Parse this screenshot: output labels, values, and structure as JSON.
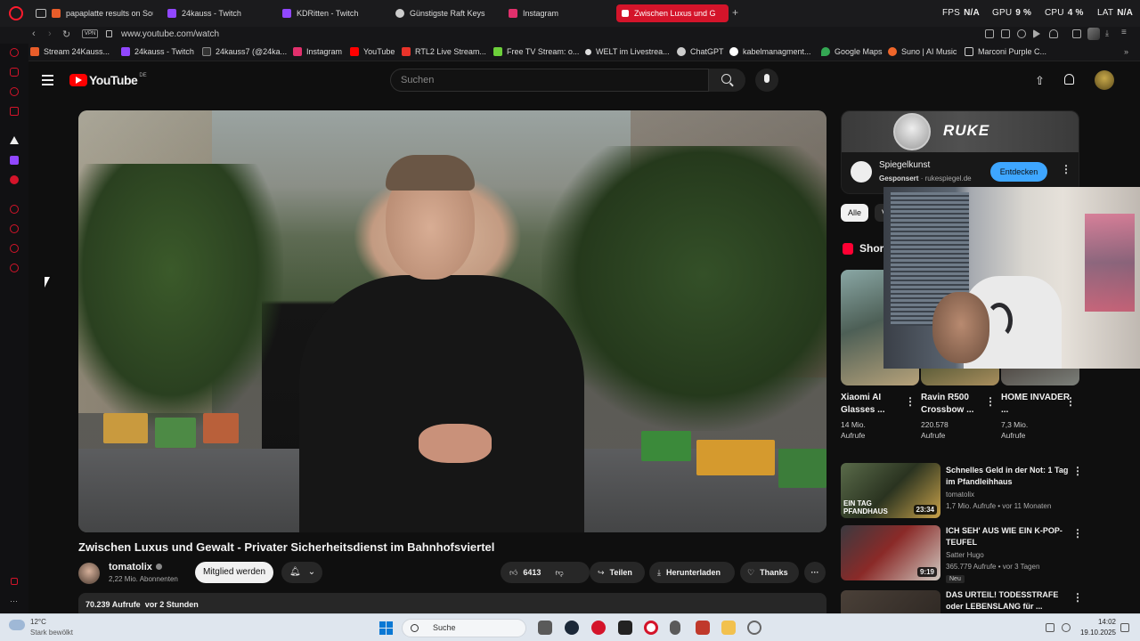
{
  "browser": {
    "tabs": [
      {
        "label": "papaplatte results on Sou",
        "color": "#e85d2a"
      },
      {
        "label": "24kauss - Twitch",
        "color": "#9147ff"
      },
      {
        "label": "KDRitten - Twitch",
        "color": "#9147ff"
      },
      {
        "label": "Günstigste Raft Keys",
        "color": "#cccccc"
      },
      {
        "label": "Instagram",
        "color": "#e1306c"
      },
      {
        "label": "Zwischen Luxus und G",
        "color": "#ff0000"
      }
    ],
    "active_tab": 5,
    "stats": [
      {
        "key": "FPS",
        "value": "N/A"
      },
      {
        "key": "GPU",
        "value": "9 %"
      },
      {
        "key": "CPU",
        "value": "4 %"
      },
      {
        "key": "LAT",
        "value": "N/A"
      }
    ],
    "vpn_label": "VPN",
    "url": "www.youtube.com/watch",
    "accent": "#d4142a"
  },
  "bookmarks": [
    {
      "label": "Stream 24Kauss...",
      "color": "#e85d2a"
    },
    {
      "label": "24kauss - Twitch",
      "color": "#9147ff"
    },
    {
      "label": "24kauss7 (@24ka...",
      "color": "#222222"
    },
    {
      "label": "Instagram",
      "color": "#e1306c"
    },
    {
      "label": "YouTube",
      "color": "#ff0000"
    },
    {
      "label": "RTL2 Live Stream...",
      "color": "#e8332a"
    },
    {
      "label": "Free TV Stream: o...",
      "color": "#6ccf3a"
    },
    {
      "label": "WELT im Livestrea...",
      "color": "#dddddd"
    },
    {
      "label": "ChatGPT",
      "color": "#cccccc"
    },
    {
      "label": "kabelmanagment...",
      "color": "#ffffff"
    },
    {
      "label": "Google Maps",
      "color": "#34a853"
    },
    {
      "label": "Suno | AI Music",
      "color": "#f0662a"
    },
    {
      "label": "Marconi Purple C...",
      "color": "#cccccc"
    }
  ],
  "youtube": {
    "logo": "YouTube",
    "country": "DE",
    "search_placeholder": "Suchen",
    "video": {
      "title": "Zwischen Luxus und Gewalt - Privater Sicherheitsdienst im Bahnhofsviertel",
      "channel": "tomatolix",
      "subscribers": "2,22 Mio. Abonnenten",
      "member_label": "Mitglied werden",
      "likes": "6413",
      "share_label": "Teilen",
      "download_label": "Herunterladen",
      "thanks_label": "Thanks",
      "views": "70.239 Aufrufe",
      "age": "vor 2 Stunden"
    },
    "ad": {
      "brand": "RUKE",
      "name": "Spiegelkunst",
      "sponsored": "Gesponsert",
      "domain": "rukespiegel.de",
      "cta": "Entdecken"
    },
    "chips": [
      "Alle",
      "V"
    ],
    "shorts_title": "Shor",
    "shorts": [
      {
        "title": "Xiaomi AI Glasses ...",
        "views": "14 Mio.",
        "unit": "Aufrufe"
      },
      {
        "title": "Ravin R500 Crossbow ...",
        "views": "220.578",
        "unit": "Aufrufe"
      },
      {
        "title": "HOME INVADER ...",
        "views": "7,3 Mio.",
        "unit": "Aufrufe"
      }
    ],
    "recommendations": [
      {
        "title": "Schnelles Geld in der Not: 1 Tag im Pfandleihhaus",
        "channel": "tomatolix",
        "meta": "1,7 Mio. Aufrufe • vor 11 Monaten",
        "duration": "23:34",
        "badge": ""
      },
      {
        "title": "ICH SEH' AUS WIE EIN K-POP-TEUFEL",
        "channel": "Satter Hugo",
        "meta": "365.779 Aufrufe • vor 3 Tagen",
        "duration": "9:19",
        "badge": "Neu"
      },
      {
        "title": "DAS URTEIL! TODESSTRAFE oder LEBENSLANG für ...",
        "channel": "",
        "meta": "",
        "duration": "",
        "badge": ""
      }
    ],
    "thumb_overlay": "EIN TAG PFANDHAUS"
  },
  "taskbar": {
    "temp": "12°C",
    "weather": "Stark bewölkt",
    "search_label": "Suche",
    "time": "14:02",
    "date": "19.10.2025"
  }
}
